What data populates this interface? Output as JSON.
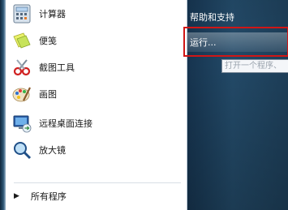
{
  "programs": [
    {
      "label": "计算器",
      "icon": "calculator-icon"
    },
    {
      "label": "便笺",
      "icon": "sticky-notes-icon"
    },
    {
      "label": "截图工具",
      "icon": "snipping-tool-icon"
    },
    {
      "label": "画图",
      "icon": "paint-icon"
    },
    {
      "label": "远程桌面连接",
      "icon": "remote-desktop-icon"
    },
    {
      "label": "放大镜",
      "icon": "magnifier-icon"
    }
  ],
  "all_programs": {
    "label": "所有程序",
    "icon": "right-arrow-icon"
  },
  "right_pane": {
    "help": "帮助和支持",
    "run": "运行...",
    "run_tooltip": "打开一个程序、"
  },
  "colors": {
    "highlight_box": "#d01616",
    "right_pane_bg": "#1d3e58"
  }
}
